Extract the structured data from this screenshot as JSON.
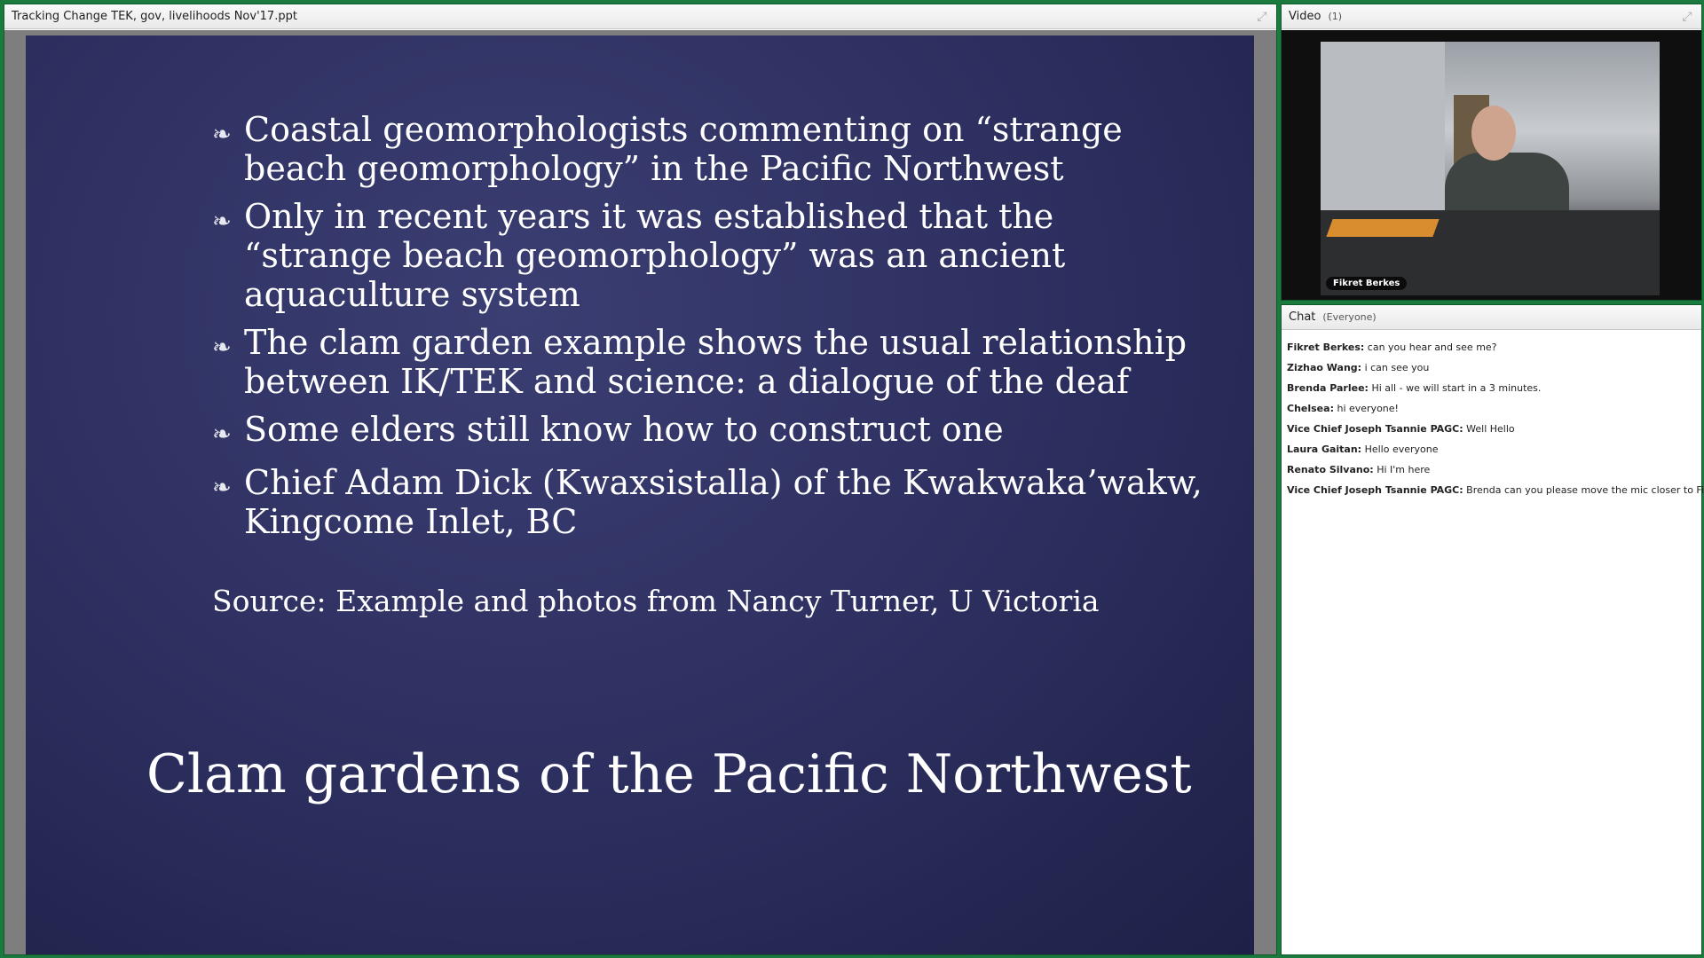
{
  "share_pod": {
    "title": "Tracking Change TEK, gov, livelihoods Nov'17.ppt",
    "expand_icon": "expand-icon"
  },
  "slide": {
    "bullet_icon": "fleuron-bullet-icon",
    "bullets": [
      "Coastal geomorphologists commenting on “strange beach geomorphology” in the Pacific Northwest",
      "Only in recent years it was established that the “strange beach geomorphology” was an ancient aquaculture system",
      "The clam garden example shows the usual relationship between IK/TEK and science: a dialogue of the deaf",
      "Some elders still know how to construct one",
      "Chief Adam Dick (Kwaxsistalla) of the Kwakwaka’wakw, Kingcome Inlet, BC"
    ],
    "source": "Source: Example and photos from Nancy Turner, U Victoria",
    "title": "Clam gardens of the Pacific Northwest"
  },
  "video_pod": {
    "title": "Video",
    "count": "(1)",
    "participant_name": "Fikret Berkes"
  },
  "chat_pod": {
    "title": "Chat",
    "audience": "(Everyone)",
    "messages": [
      {
        "sender": "Fikret Berkes:",
        "text": "can you hear and see me?"
      },
      {
        "sender": "Zizhao Wang:",
        "text": "i can see you"
      },
      {
        "sender": "Brenda Parlee:",
        "text": "Hi all - we will start in a 3 minutes."
      },
      {
        "sender": "Chelsea:",
        "text": "hi everyone!"
      },
      {
        "sender": "Vice Chief Joseph Tsannie PAGC:",
        "text": "Well Hello"
      },
      {
        "sender": "Laura Gaitan:",
        "text": "Hello everyone"
      },
      {
        "sender": "Renato Silvano:",
        "text": "Hi I'm here"
      },
      {
        "sender": "Vice Chief Joseph Tsannie PAGC:",
        "text": "Brenda can you please move the mic closer to Fikret??"
      }
    ]
  },
  "colors": {
    "frame_green": "#1b7a3e",
    "slide_bg": "#2c2e5e"
  }
}
